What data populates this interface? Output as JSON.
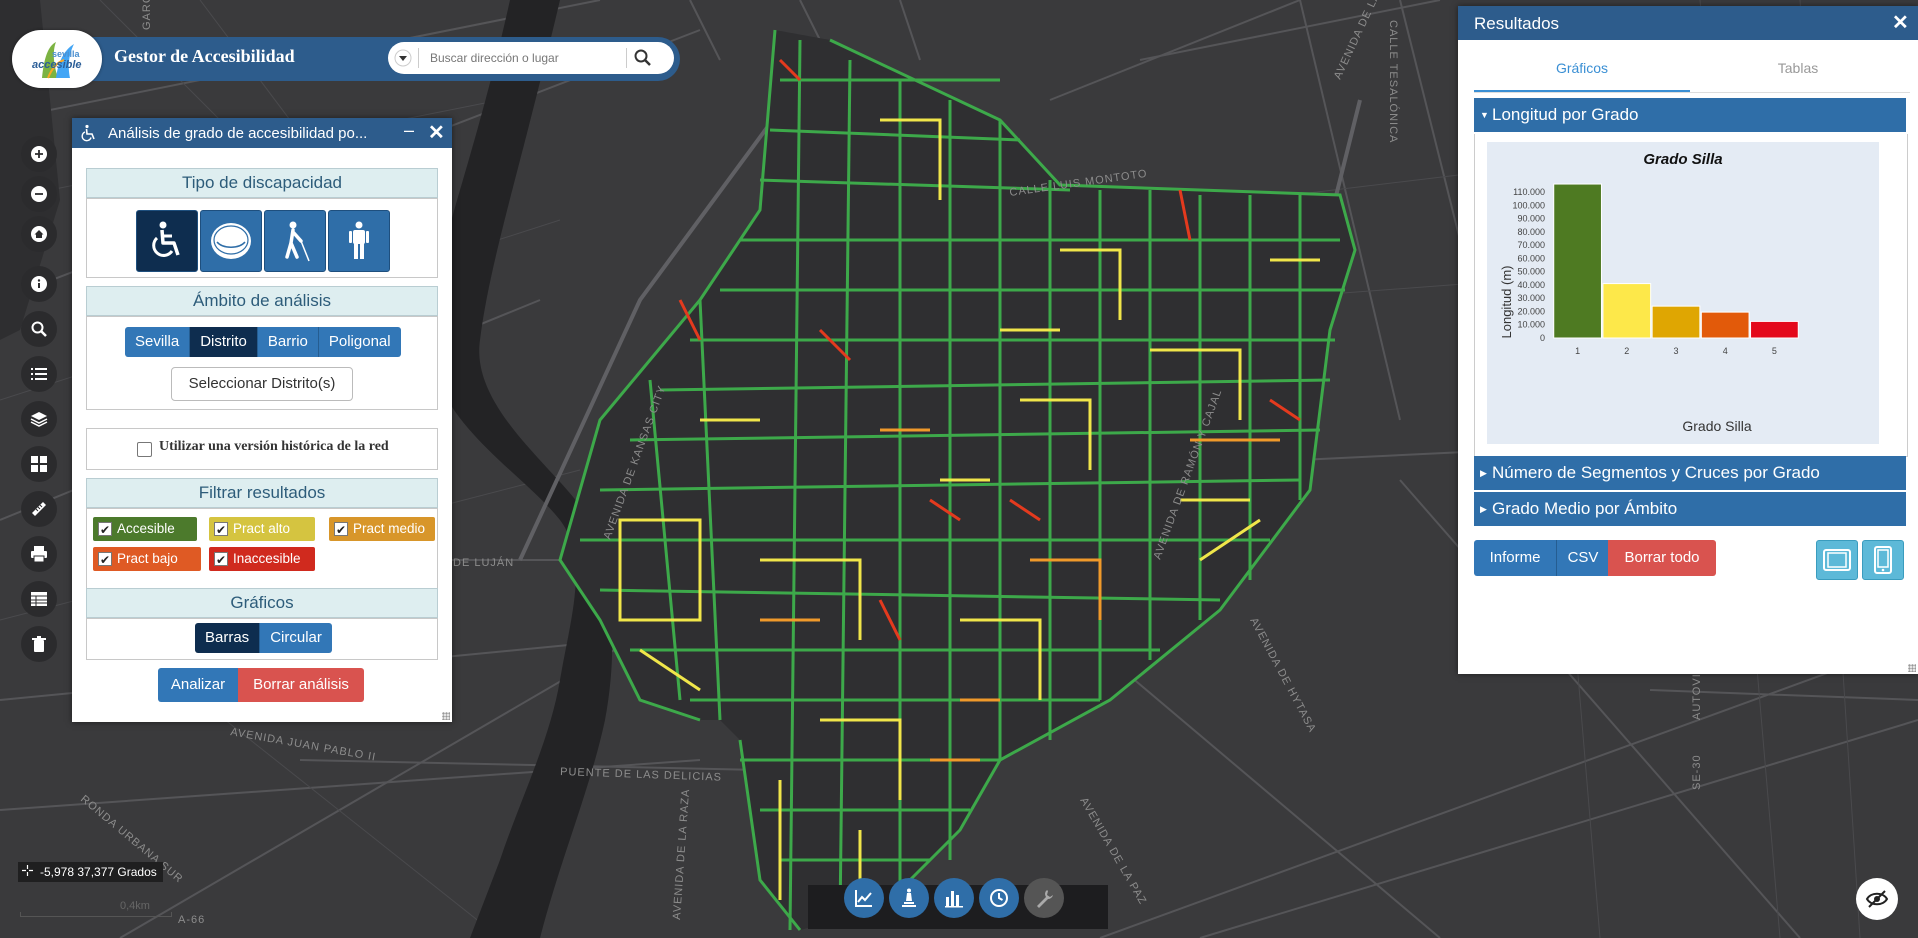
{
  "header": {
    "logo_top": "sevilla",
    "logo_bottom": "accesible",
    "title": "Gestor de Accesibilidad",
    "search_placeholder": "Buscar dirección o lugar"
  },
  "toolbar": {
    "icons": [
      "zoom-in-icon",
      "zoom-out-icon",
      "home-icon",
      "info-icon",
      "search-icon",
      "list-icon",
      "layers-icon",
      "grid-icon",
      "ruler-icon",
      "print-icon",
      "table-icon",
      "trash-icon"
    ]
  },
  "analysis_panel": {
    "title": "Análisis de grado de accesibilidad po...",
    "minimize": "–",
    "close": "✕",
    "disability_header": "Tipo de discapacidad",
    "disability_buttons": [
      "wheelchair-icon",
      "stroller-icon",
      "blind-person-icon",
      "standing-person-icon"
    ],
    "disability_selected": "wheelchair-icon",
    "scope_header": "Ámbito de análisis",
    "scope_options": [
      "Sevilla",
      "Distrito",
      "Barrio",
      "Poligonal"
    ],
    "scope_selected": "Distrito",
    "select_button": "Seleccionar Distrito(s)",
    "historic_label": "Utilizar una versión histórica de la red",
    "historic_checked": false,
    "filter_header": "Filtrar resultados",
    "filters": [
      {
        "label": "Accesible",
        "color": "#4c7a2c",
        "checked": true
      },
      {
        "label": "Pract alto",
        "color": "#d5c440",
        "checked": true
      },
      {
        "label": "Pract medio",
        "color": "#d8962a",
        "checked": true
      },
      {
        "label": "Pract bajo",
        "color": "#df5a24",
        "checked": true
      },
      {
        "label": "Inaccesible",
        "color": "#d02a1e",
        "checked": true
      }
    ],
    "charts_header": "Gráficos",
    "chart_options": [
      "Barras",
      "Circular"
    ],
    "chart_selected": "Barras",
    "analyze_button": "Analizar",
    "clear_button": "Borrar análisis"
  },
  "results_panel": {
    "title": "Resultados",
    "close": "✕",
    "tabs": [
      {
        "label": "Gráficos",
        "active": true
      },
      {
        "label": "Tablas",
        "active": false
      }
    ],
    "sections": [
      {
        "label": "Longitud por Grado",
        "expanded": true
      },
      {
        "label": "Número de Segmentos y Cruces por Grado",
        "expanded": false
      },
      {
        "label": "Grado Medio por Ámbito",
        "expanded": false
      }
    ],
    "buttons": [
      "Informe",
      "CSV",
      "Borrar todo"
    ],
    "device_icons": [
      "tablet-icon",
      "phone-icon"
    ]
  },
  "chart_data": {
    "type": "bar",
    "title": "Grado Silla",
    "xlabel": "Grado Silla",
    "ylabel": "Longitud (m)",
    "categories": [
      "1",
      "2",
      "3",
      "4",
      "5"
    ],
    "values": [
      116000,
      41000,
      24000,
      19500,
      12500
    ],
    "colors": [
      "#4e7a22",
      "#fde84a",
      "#dfa602",
      "#e25a0a",
      "#e4091b"
    ],
    "ylim": [
      0,
      110000
    ],
    "yticks": [
      "0",
      "10.000",
      "20.000",
      "30.000",
      "40.000",
      "50.000",
      "60.000",
      "70.000",
      "80.000",
      "90.000",
      "100.000",
      "110.000"
    ],
    "grid": false
  },
  "map_labels": {
    "street_1": "CALLE LUIS MONTOTO",
    "street_2": "AVENIDA DE HYTASA",
    "street_3": "PUENTE DE LAS DELICIAS",
    "street_4": "AVENIDA JUAN PABLO II",
    "street_5": "RONDA URBANA SUR",
    "street_6": "AVENIDA DE LA PAZ",
    "street_7": "AVENIDA DE LA RAZA",
    "street_8": "SE-30",
    "street_9": "AUTOVIA",
    "street_10": "A-66",
    "street_11": "DE LUJÁN",
    "street_12": "CALLE TESALÓNICA",
    "street_13": "AVENIDA DE KANSAS CITY",
    "street_14": "AVENIDA DE LA BOR",
    "street_15": "GARCIA",
    "street_16": "AVENIDA DE RAMÓN Y CAJAL"
  },
  "status": {
    "coordinates": "-5,978 37,377 Grados",
    "scale": "0,4km"
  },
  "bottom_toolbar": {
    "icons": [
      "line-chart-icon",
      "statue-icon",
      "bar-chart-icon",
      "clock-icon",
      "wrench-icon"
    ],
    "hide_icon": "eye-off-icon"
  }
}
